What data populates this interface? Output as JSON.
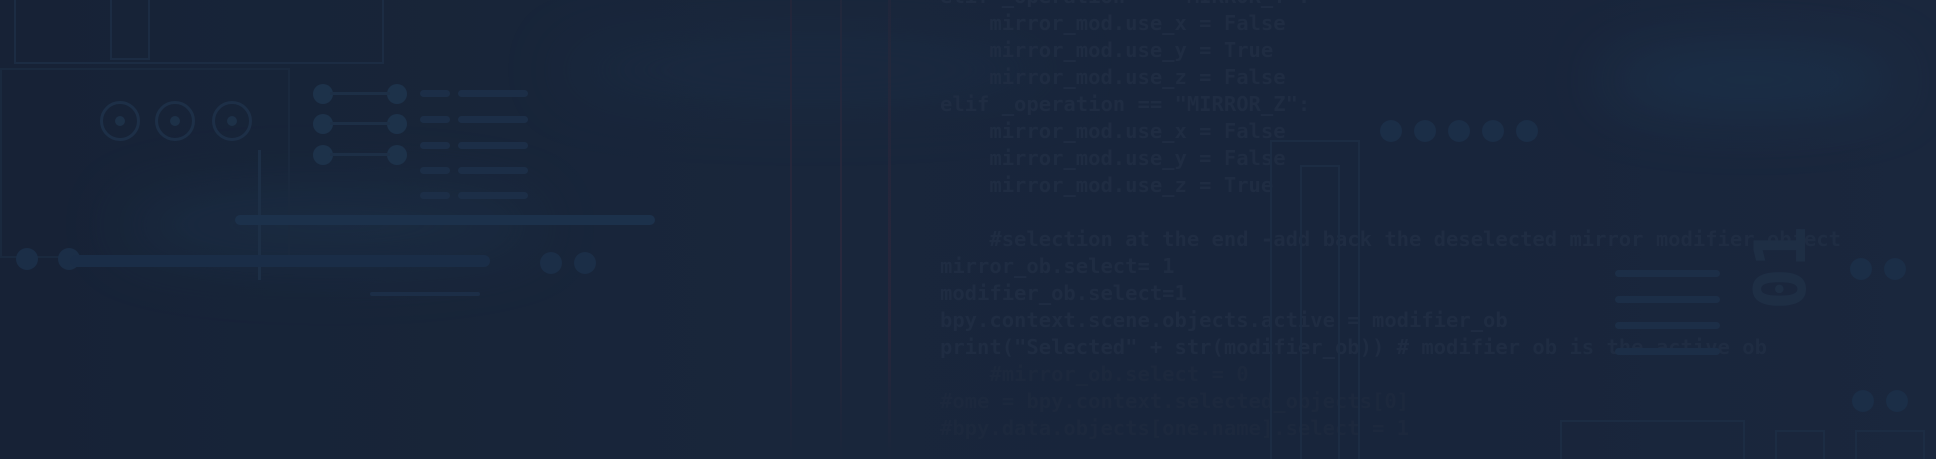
{
  "code_lines": [
    "elif _operation == \"MIRROR_Y\":",
    "    mirror_mod.use_x = False",
    "    mirror_mod.use_y = True",
    "    mirror_mod.use_z = False",
    "elif _operation == \"MIRROR_Z\":",
    "    mirror_mod.use_x = False",
    "    mirror_mod.use_y = False",
    "    mirror_mod.use_z = True",
    "",
    "    #selection at the end -add back the deselected mirror modifier object",
    "mirror_ob.select= 1",
    "modifier_ob.select=1",
    "bpy.context.scene.objects.active = modifier_ob",
    "print(\"Selected\" + str(modifier_ob)) # modifier ob is the active ob",
    "    #mirror_ob.select = 0",
    "#ome = bpy.context.selected_objects[0]",
    "#bpy.data.objects[one.name].select = 1"
  ],
  "binary_text": "01",
  "colors": {
    "background": "#1a263a",
    "code_text": "#23324a",
    "circuit": "#20364f",
    "streak": "#3a2a40"
  }
}
